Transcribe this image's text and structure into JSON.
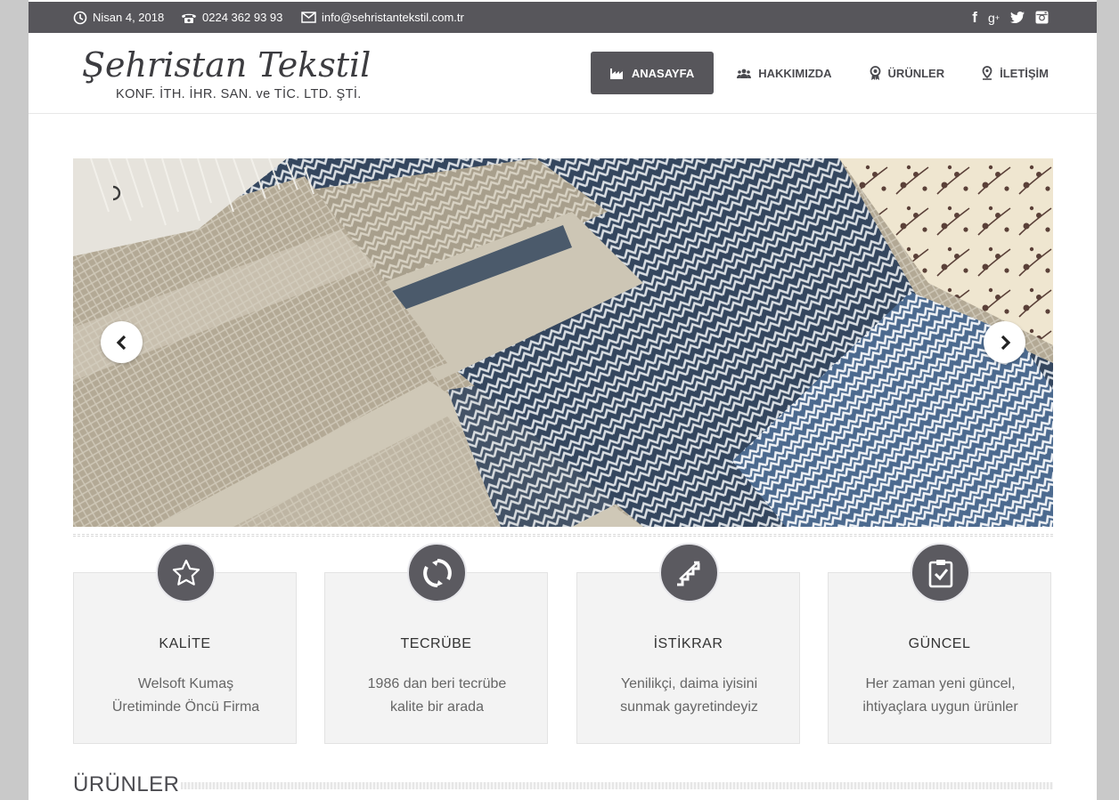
{
  "topbar": {
    "date": "Nisan 4, 2018",
    "phone": "0224 362 93 93",
    "email": "info@sehristantekstil.com.tr",
    "social": [
      "f",
      "g+",
      "twitter",
      "instagram"
    ]
  },
  "logo": {
    "name": "Şehristan Tekstil",
    "subtitle": "KONF. İTH. İHR. SAN. ve TİC. LTD. ŞTİ."
  },
  "nav": {
    "items": [
      {
        "label": "ANASAYFA",
        "icon": "factory-icon",
        "active": true
      },
      {
        "label": "HAKKIMIZDA",
        "icon": "users-icon",
        "active": false
      },
      {
        "label": "ÜRÜNLER",
        "icon": "award-icon",
        "active": false
      },
      {
        "label": "İLETİŞİM",
        "icon": "map-pin-icon",
        "active": false
      }
    ]
  },
  "slider": {
    "prev_icon": "chevron-left-icon",
    "next_icon": "chevron-right-icon"
  },
  "features": [
    {
      "title": "KALİTE",
      "desc1": "Welsoft Kumaş",
      "desc2": "Üretiminde Öncü Firma",
      "icon": "star-icon"
    },
    {
      "title": "TECRÜBE",
      "desc1": "1986 dan beri tecrübe",
      "desc2": "kalite bir arada",
      "icon": "refresh-icon"
    },
    {
      "title": "İSTİKRAR",
      "desc1": "Yenilikçi, daima iyisini",
      "desc2": "sunmak gayretindeyiz",
      "icon": "stairs-icon"
    },
    {
      "title": "GÜNCEL",
      "desc1": "Her zaman yeni güncel,",
      "desc2": "ihtiyaçlara uygun ürünler",
      "icon": "clipboard-check-icon"
    }
  ],
  "section": {
    "title": "ÜRÜNLER"
  },
  "colors": {
    "topbar": "#57565b",
    "accent": "#57565b",
    "feature_bg": "#f3f3f3",
    "outer_bg": "#c9c9c9"
  }
}
